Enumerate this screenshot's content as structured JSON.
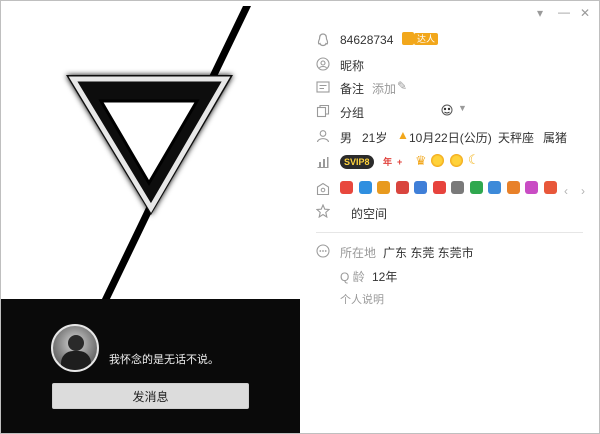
{
  "profile": {
    "qq_number": "84628734",
    "badge_text": "达人",
    "nickname_label": "昵称",
    "remark_label": "备注",
    "remark_add": "添加",
    "group_label": "分组",
    "gender": "男",
    "age": "21岁",
    "birthday": "10月22日(公历)",
    "zodiac": "天秤座",
    "chinese_zodiac": "属猪",
    "vip_level": "SVIP8",
    "vip_year": "年",
    "vip_plus": "+",
    "space_label": "的空间",
    "location_label": "所在地",
    "location_value": "广东 东莞 东莞市",
    "qage_label": "Q 龄",
    "qage_value": "12年",
    "bio_label": "个人说明"
  },
  "left": {
    "signature": "我怀念的是无话不说。",
    "send_button": "发消息"
  },
  "colors": {
    "accent": "#f2a71b",
    "icon_gray": "#9a9a9a"
  },
  "service_icons": [
    {
      "icon": "heart-icon",
      "color": "#e8473d"
    },
    {
      "icon": "game-icon",
      "color": "#2f8fe0"
    },
    {
      "icon": "paint-icon",
      "color": "#e89a1f"
    },
    {
      "icon": "music-icon",
      "color": "#d9453e"
    },
    {
      "icon": "star-icon",
      "color": "#3f7fd8"
    },
    {
      "icon": "gift-icon",
      "color": "#e7433d"
    },
    {
      "icon": "mail-icon",
      "color": "#7a7a7a"
    },
    {
      "icon": "leaf-icon",
      "color": "#2fa84f"
    },
    {
      "icon": "camera-icon",
      "color": "#3d8ad9"
    },
    {
      "icon": "hat-icon",
      "color": "#e8812a"
    },
    {
      "icon": "box-icon",
      "color": "#c94cc4"
    },
    {
      "icon": "fire-icon",
      "color": "#e8573a"
    }
  ]
}
